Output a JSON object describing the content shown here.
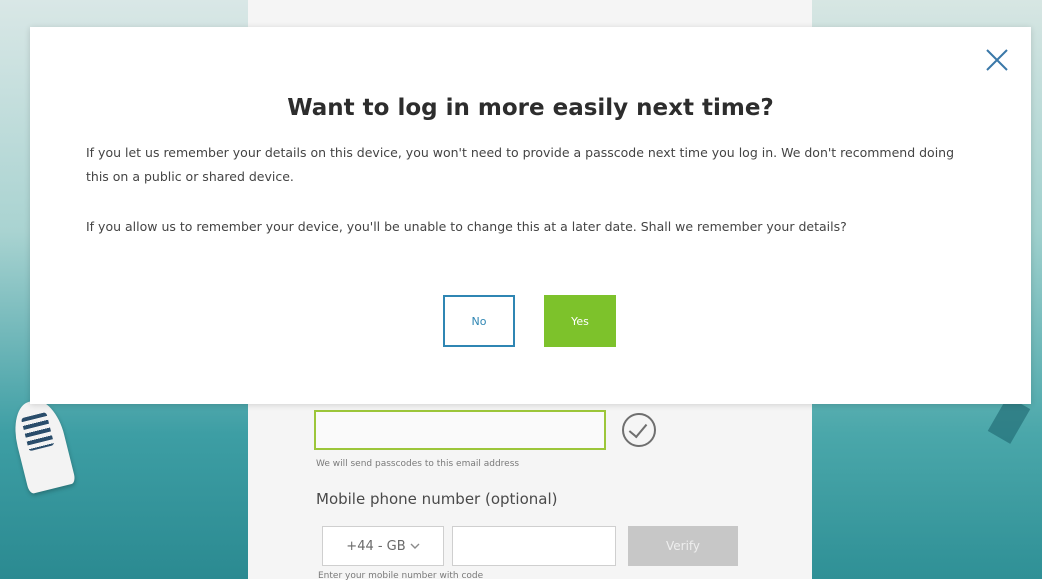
{
  "modal": {
    "title": "Want to log in more easily next time?",
    "paragraph1": "If you let us remember your details on this device, you won't need to provide a passcode next time you log in. We don't recommend doing this on a public or shared device.",
    "paragraph2": "If you allow us to remember your device, you'll be unable to change this at a later date. Shall we remember your details?",
    "no_label": "No",
    "yes_label": "Yes",
    "close_icon": "close-icon"
  },
  "form": {
    "email_help": "We will send passcodes to this email address",
    "phone_label": "Mobile phone number (optional)",
    "country_code": "+44 - GB",
    "verify_label": "Verify",
    "phone_help": "Enter your mobile number with code"
  },
  "colors": {
    "yes_button": "#7dc22b",
    "no_border": "#2f86b3",
    "input_valid_border": "#9cc63a"
  }
}
